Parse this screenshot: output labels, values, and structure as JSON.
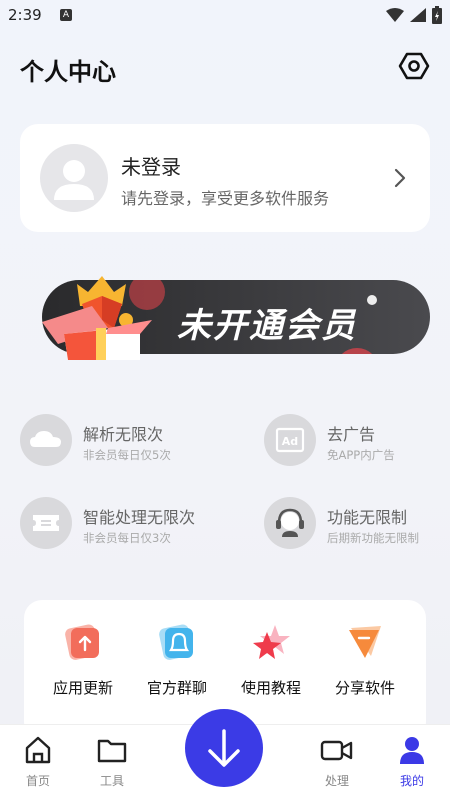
{
  "status_bar": {
    "time": "2:39",
    "notif_letter": "A"
  },
  "header": {
    "title": "个人中心"
  },
  "profile": {
    "title": "未登录",
    "subtitle": "请先登录，享受更多软件服务"
  },
  "vip_banner": {
    "text": "未开通会员"
  },
  "features": [
    {
      "title": "解析无限次",
      "subtitle": "非会员每日仅5次",
      "icon": "cloud-icon"
    },
    {
      "title": "去广告",
      "subtitle": "免APP内广告",
      "icon": "ad-icon"
    },
    {
      "title": "智能处理无限次",
      "subtitle": "非会员每日仅3次",
      "icon": "ticket-icon"
    },
    {
      "title": "功能无限制",
      "subtitle": "后期新功能无限制",
      "icon": "headset-icon"
    }
  ],
  "tools": [
    {
      "label": "应用更新",
      "icon": "update-icon"
    },
    {
      "label": "官方群聊",
      "icon": "group-chat-icon"
    },
    {
      "label": "使用教程",
      "icon": "tutorial-icon"
    },
    {
      "label": "分享软件",
      "icon": "share-icon"
    }
  ],
  "nav": [
    {
      "label": "首页",
      "icon": "home-icon"
    },
    {
      "label": "工具",
      "icon": "folder-icon"
    },
    {
      "label": "处理",
      "icon": "video-icon"
    },
    {
      "label": "我的",
      "icon": "user-icon",
      "active": true
    }
  ],
  "colors": {
    "accent": "#3b3be6",
    "vip_bg": "#2a2a2c"
  }
}
